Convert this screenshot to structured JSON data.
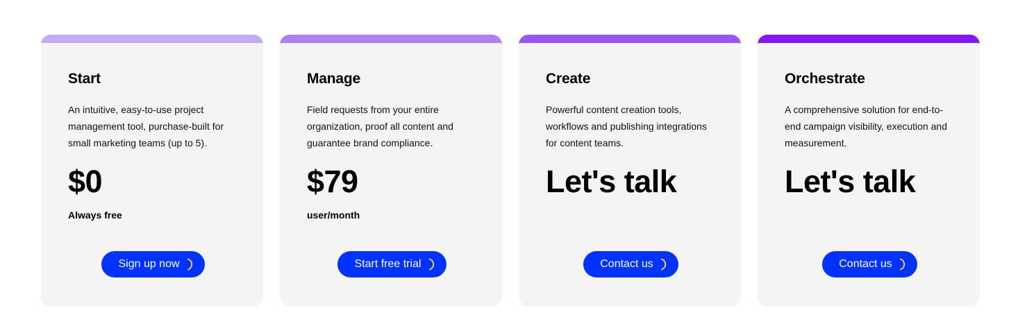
{
  "plans": [
    {
      "name": "Start",
      "description": "An intuitive, easy-to-use project management tool, purchase-built for small marketing teams (up to 5).",
      "price": "$0",
      "price_unit": "Always free",
      "cta_label": "Sign up now",
      "accent_color": "#c7a8f5"
    },
    {
      "name": "Manage",
      "description": "Field requests from your entire organization, proof all content and guarantee brand compliance.",
      "price": "$79",
      "price_unit": "user/month",
      "cta_label": "Start free trial",
      "accent_color": "#b07ff2"
    },
    {
      "name": "Create",
      "description": "Powerful content creation tools, workflows and publishing integrations for content teams.",
      "price": "Let's talk",
      "price_unit": "",
      "cta_label": "Contact us",
      "accent_color": "#9a55f2"
    },
    {
      "name": "Orchestrate",
      "description": "A comprehensive solution for end-to-end campaign visibility, execution and measurement.",
      "price": "Let's talk",
      "price_unit": "",
      "cta_label": "Contact us",
      "accent_color": "#8417f5"
    }
  ],
  "colors": {
    "button_bg": "#0033ff",
    "button_text": "#ffffff",
    "button_icon": "#f5c443",
    "card_bg": "#f4f4f4"
  },
  "icons": {
    "cta_icon": "arc-icon"
  }
}
